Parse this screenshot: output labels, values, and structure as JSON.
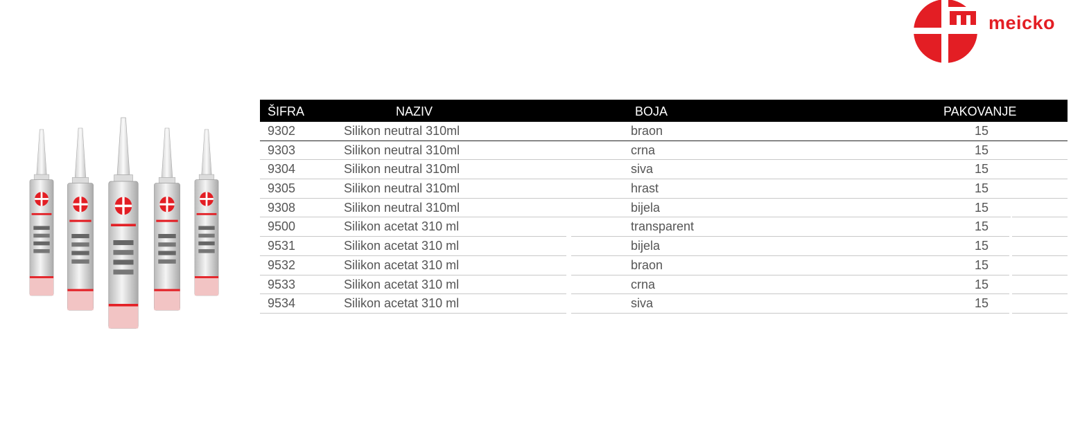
{
  "brand": {
    "name": "meicko",
    "accent": "#e31e24"
  },
  "table": {
    "headers": {
      "code": "ŠIFRA",
      "name": "NAZIV",
      "color": "BOJA",
      "pack": "PAKOVANJE"
    },
    "rows": [
      {
        "code": "9302",
        "name": "Silikon neutral 310ml",
        "color": "braon",
        "pack": "15"
      },
      {
        "code": "9303",
        "name": "Silikon neutral 310ml",
        "color": "crna",
        "pack": "15"
      },
      {
        "code": "9304",
        "name": "Silikon neutral 310ml",
        "color": "siva",
        "pack": "15"
      },
      {
        "code": "9305",
        "name": "Silikon neutral 310ml",
        "color": "hrast",
        "pack": "15"
      },
      {
        "code": "9308",
        "name": "Silikon neutral 310ml",
        "color": "bijela",
        "pack": "15"
      },
      {
        "code": "9500",
        "name": "Silikon acetat 310 ml",
        "color": "transparent",
        "pack": "15"
      },
      {
        "code": "9531",
        "name": "Silikon acetat 310 ml",
        "color": "bijela",
        "pack": "15"
      },
      {
        "code": "9532",
        "name": "Silikon acetat 310 ml",
        "color": "braon",
        "pack": "15"
      },
      {
        "code": "9533",
        "name": "Silikon acetat 310 ml",
        "color": "crna",
        "pack": "15"
      },
      {
        "code": "9534",
        "name": "Silikon acetat 310 ml",
        "color": "siva",
        "pack": "15"
      }
    ]
  }
}
